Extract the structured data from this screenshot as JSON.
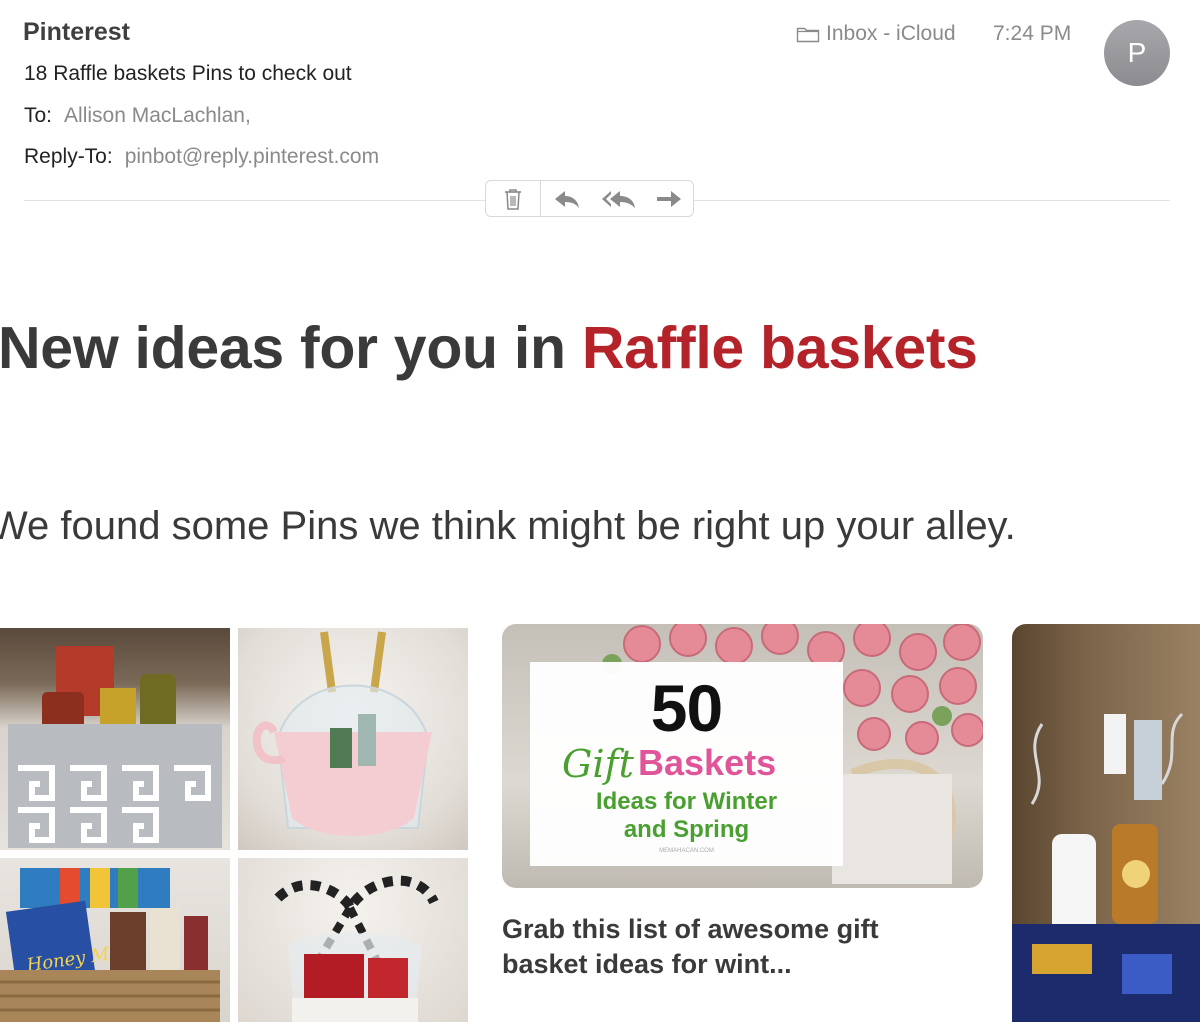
{
  "header": {
    "sender": "Pinterest",
    "subject": "18 Raffle baskets Pins to check out",
    "to_label": "To:",
    "to_value": "Allison MacLachlan,",
    "reply_to_label": "Reply-To:",
    "reply_to_value": "pinbot@reply.pinterest.com",
    "mailbox": "Inbox - iCloud",
    "time": "7:24 PM",
    "avatar_initial": "P"
  },
  "toolbar": {
    "icons": [
      "trash-icon",
      "reply-icon",
      "reply-all-icon",
      "forward-icon"
    ]
  },
  "body": {
    "headline_prefix": "New ideas for you in ",
    "headline_accent": "Raffle baskets",
    "intro": "We found some Pins we think might be right up your alley."
  },
  "pins": {
    "card_number": "50",
    "card_gift": "Gift",
    "card_baskets": "Baskets",
    "card_line1": "Ideas for Winter",
    "card_line2": "and Spring",
    "card_small": "MEMAHACAN.COM",
    "caption": "Grab this list of awesome gift basket ideas for wint..."
  },
  "colors": {
    "accent": "#b5232a",
    "gift_green": "#49a030",
    "baskets_pink": "#e0559a"
  }
}
